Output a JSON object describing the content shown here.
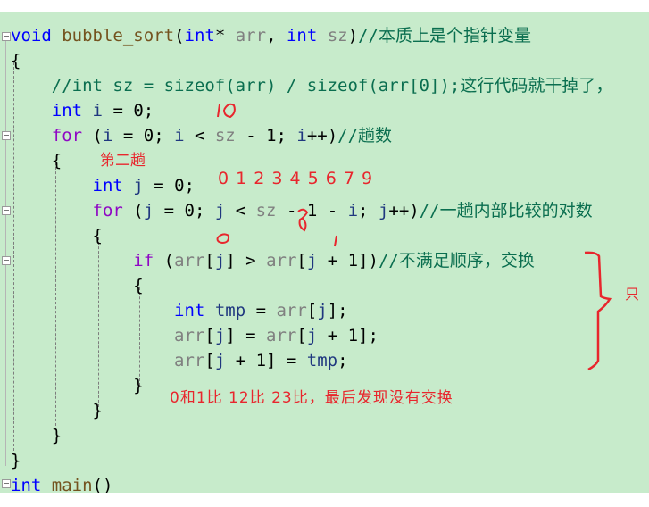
{
  "code_lines": [
    {
      "tokens": [
        {
          "t": "void",
          "c": "kw"
        },
        {
          "t": " ",
          "c": "pl"
        },
        {
          "t": "bubble_sort",
          "c": "fn"
        },
        {
          "t": "(",
          "c": "pl"
        },
        {
          "t": "int",
          "c": "kw"
        },
        {
          "t": "* ",
          "c": "pl"
        },
        {
          "t": "arr",
          "c": "prm"
        },
        {
          "t": ", ",
          "c": "pl"
        },
        {
          "t": "int",
          "c": "kw"
        },
        {
          "t": " ",
          "c": "pl"
        },
        {
          "t": "sz",
          "c": "prm"
        },
        {
          "t": ")",
          "c": "pl"
        },
        {
          "t": "//本质上是个指针变量",
          "c": "cm"
        }
      ]
    },
    {
      "tokens": [
        {
          "t": "{",
          "c": "pl"
        }
      ]
    },
    {
      "tokens": [
        {
          "t": "    //int sz = sizeof(arr) / sizeof(arr[0]);这行代码就干掉了，",
          "c": "cm"
        }
      ]
    },
    {
      "tokens": [
        {
          "t": "    ",
          "c": "pl"
        },
        {
          "t": "int",
          "c": "kw"
        },
        {
          "t": " ",
          "c": "pl"
        },
        {
          "t": "i",
          "c": "var"
        },
        {
          "t": " = 0;",
          "c": "pl"
        }
      ]
    },
    {
      "tokens": [
        {
          "t": "    ",
          "c": "pl"
        },
        {
          "t": "for",
          "c": "kw2"
        },
        {
          "t": " (",
          "c": "pl"
        },
        {
          "t": "i",
          "c": "var"
        },
        {
          "t": " = 0; ",
          "c": "pl"
        },
        {
          "t": "i",
          "c": "var"
        },
        {
          "t": " < ",
          "c": "pl"
        },
        {
          "t": "sz",
          "c": "prm"
        },
        {
          "t": " - 1; ",
          "c": "pl"
        },
        {
          "t": "i",
          "c": "var"
        },
        {
          "t": "++)",
          "c": "pl"
        },
        {
          "t": "//趟数",
          "c": "cm"
        }
      ]
    },
    {
      "tokens": [
        {
          "t": "    {",
          "c": "pl"
        }
      ]
    },
    {
      "tokens": [
        {
          "t": "        ",
          "c": "pl"
        },
        {
          "t": "int",
          "c": "kw"
        },
        {
          "t": " ",
          "c": "pl"
        },
        {
          "t": "j",
          "c": "var"
        },
        {
          "t": " = 0;",
          "c": "pl"
        }
      ]
    },
    {
      "tokens": [
        {
          "t": "        ",
          "c": "pl"
        },
        {
          "t": "for",
          "c": "kw2"
        },
        {
          "t": " (",
          "c": "pl"
        },
        {
          "t": "j",
          "c": "var"
        },
        {
          "t": " = 0; ",
          "c": "pl"
        },
        {
          "t": "j",
          "c": "var"
        },
        {
          "t": " < ",
          "c": "pl"
        },
        {
          "t": "sz",
          "c": "prm"
        },
        {
          "t": " - 1 - ",
          "c": "pl"
        },
        {
          "t": "i",
          "c": "var"
        },
        {
          "t": "; ",
          "c": "pl"
        },
        {
          "t": "j",
          "c": "var"
        },
        {
          "t": "++)",
          "c": "pl"
        },
        {
          "t": "//一趟内部比较的对数",
          "c": "cm"
        }
      ]
    },
    {
      "tokens": [
        {
          "t": "        {",
          "c": "pl"
        }
      ]
    },
    {
      "tokens": [
        {
          "t": "            ",
          "c": "pl"
        },
        {
          "t": "if",
          "c": "kw2"
        },
        {
          "t": " (",
          "c": "pl"
        },
        {
          "t": "arr",
          "c": "prm"
        },
        {
          "t": "[",
          "c": "pl"
        },
        {
          "t": "j",
          "c": "var"
        },
        {
          "t": "] > ",
          "c": "pl"
        },
        {
          "t": "arr",
          "c": "prm"
        },
        {
          "t": "[",
          "c": "pl"
        },
        {
          "t": "j",
          "c": "var"
        },
        {
          "t": " + 1])",
          "c": "pl"
        },
        {
          "t": "//不满足顺序，交换",
          "c": "cm"
        }
      ]
    },
    {
      "tokens": [
        {
          "t": "            {",
          "c": "pl"
        }
      ]
    },
    {
      "tokens": [
        {
          "t": "                ",
          "c": "pl"
        },
        {
          "t": "int",
          "c": "kw"
        },
        {
          "t": " ",
          "c": "pl"
        },
        {
          "t": "tmp",
          "c": "var"
        },
        {
          "t": " = ",
          "c": "pl"
        },
        {
          "t": "arr",
          "c": "prm"
        },
        {
          "t": "[",
          "c": "pl"
        },
        {
          "t": "j",
          "c": "var"
        },
        {
          "t": "];",
          "c": "pl"
        }
      ]
    },
    {
      "tokens": [
        {
          "t": "                ",
          "c": "pl"
        },
        {
          "t": "arr",
          "c": "prm"
        },
        {
          "t": "[",
          "c": "pl"
        },
        {
          "t": "j",
          "c": "var"
        },
        {
          "t": "] = ",
          "c": "pl"
        },
        {
          "t": "arr",
          "c": "prm"
        },
        {
          "t": "[",
          "c": "pl"
        },
        {
          "t": "j",
          "c": "var"
        },
        {
          "t": " + 1];",
          "c": "pl"
        }
      ]
    },
    {
      "tokens": [
        {
          "t": "                ",
          "c": "pl"
        },
        {
          "t": "arr",
          "c": "prm"
        },
        {
          "t": "[",
          "c": "pl"
        },
        {
          "t": "j",
          "c": "var"
        },
        {
          "t": " + 1] = ",
          "c": "pl"
        },
        {
          "t": "tmp",
          "c": "var"
        },
        {
          "t": ";",
          "c": "pl"
        }
      ]
    },
    {
      "tokens": [
        {
          "t": "            }",
          "c": "pl"
        }
      ]
    },
    {
      "tokens": [
        {
          "t": "        }",
          "c": "pl"
        }
      ]
    },
    {
      "tokens": [
        {
          "t": "    }",
          "c": "pl"
        }
      ]
    },
    {
      "tokens": [
        {
          "t": "}",
          "c": "pl"
        }
      ]
    },
    {
      "tokens": [
        {
          "t": "int",
          "c": "kw"
        },
        {
          "t": " ",
          "c": "pl"
        },
        {
          "t": "main",
          "c": "fn"
        },
        {
          "t": "()",
          "c": "pl"
        }
      ]
    }
  ],
  "annotations": {
    "second_pass": "第二趟",
    "index_digits": "0 1 2 3 4 5 6 7 9",
    "ten_mark": "10",
    "eight_mark": "8",
    "zero_mark": "0",
    "one_mark": "1",
    "compare_note": "0和1比 12比 23比，最后发现没有交换",
    "side_note": "只"
  },
  "colors": {
    "editor_bg": "#c7ebcb",
    "annotation_red": "#e8262d"
  }
}
